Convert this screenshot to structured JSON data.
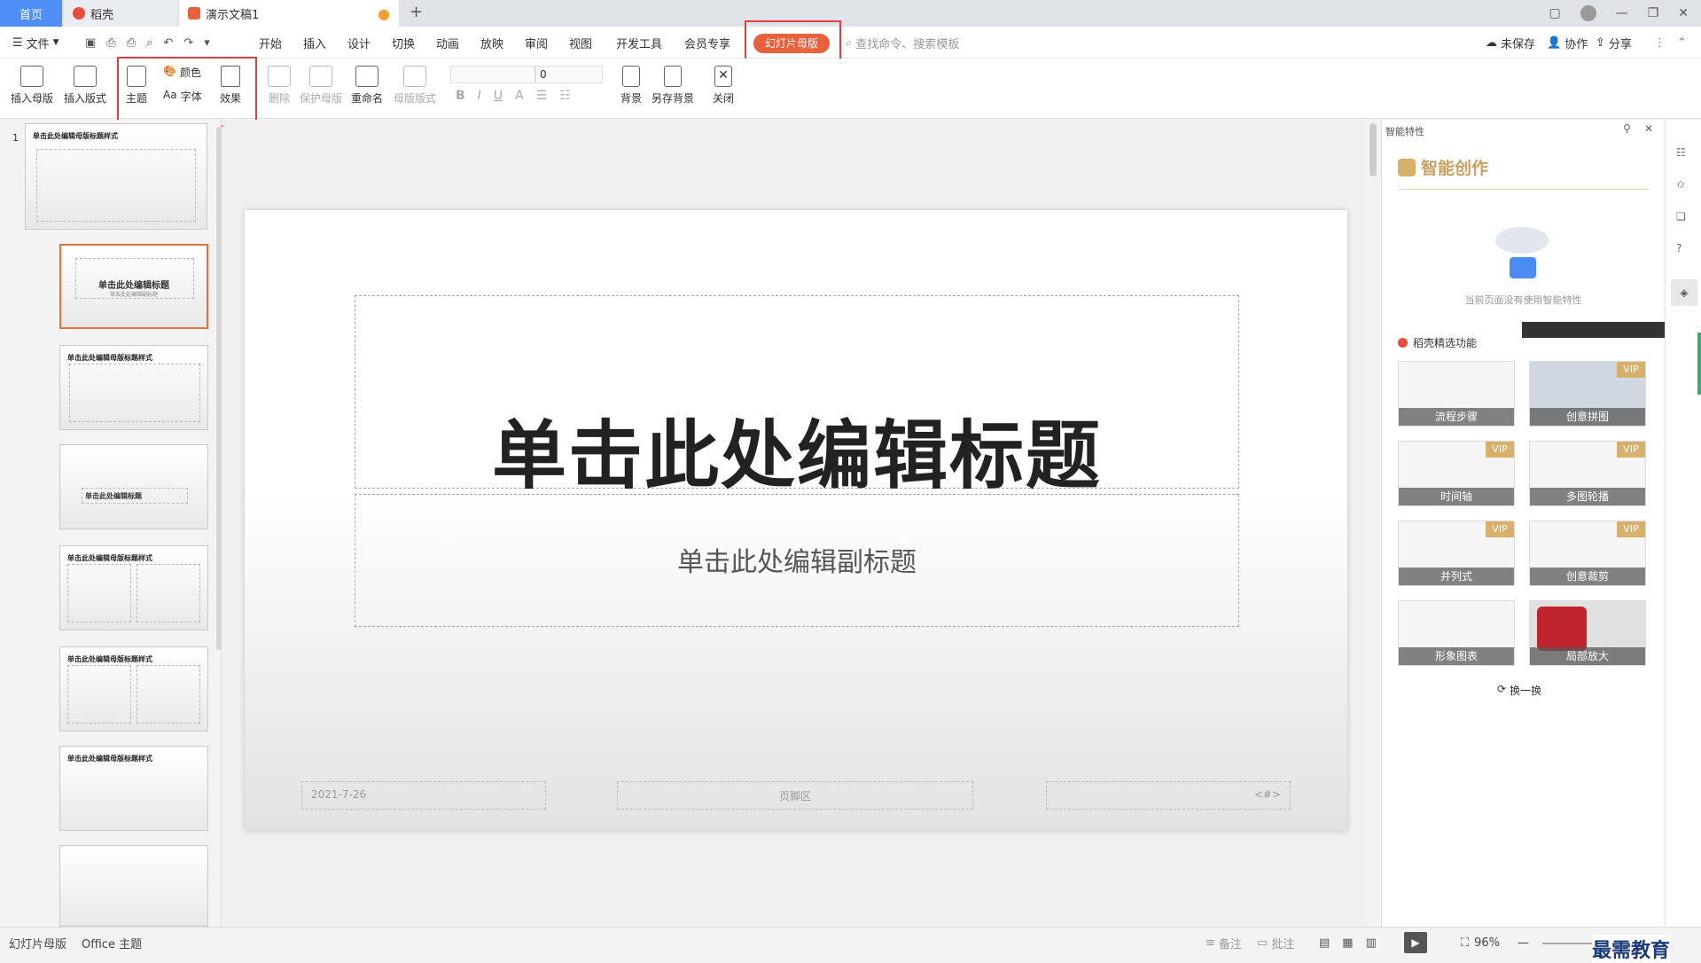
{
  "tabs": {
    "home": "首页",
    "docer": "稻壳",
    "doc": "演示文稿1"
  },
  "menu": {
    "file": "文件",
    "items": [
      "开始",
      "插入",
      "设计",
      "切换",
      "动画",
      "放映",
      "审阅",
      "视图",
      "开发工具",
      "会员专享"
    ],
    "active": "幻灯片母版",
    "search": "查找命令、搜索模板",
    "unsaved": "未保存",
    "collab": "协作",
    "share": "分享"
  },
  "ribbon": {
    "insert_master": "插入母版",
    "insert_layout": "插入版式",
    "theme": "主题",
    "color": "颜色",
    "font": "字体",
    "font_prefix": "Aa",
    "effect": "效果",
    "delete": "删除",
    "protect": "保护母版",
    "rename": "重命名",
    "master_layout": "母版版式",
    "font_size": "0",
    "background": "背景",
    "save_bg": "另存背景",
    "close": "关闭"
  },
  "thumbs": {
    "num": "1",
    "master_title": "单击此处编辑母版标题样式",
    "t2": "单击此处编辑标题",
    "t2sub": "单击此处编辑副标题",
    "t4": "单击此处编辑标题"
  },
  "slide": {
    "title": "单击此处编辑标题",
    "subtitle": "单击此处编辑副标题",
    "date": "2021-7-26",
    "footer": "页脚区",
    "num": "<#>"
  },
  "rpanel": {
    "header": "智能特性",
    "smart": "智能创作",
    "empty": "当前页面没有使用智能特性",
    "section": "稻壳精选功能",
    "refresh": "换一换",
    "vip": "VIP",
    "features": [
      "流程步骤",
      "创意拼图",
      "时间轴",
      "多图轮播",
      "并列式",
      "创意裁剪",
      "形象图表",
      "局部放大"
    ]
  },
  "status": {
    "mode": "幻灯片母版",
    "theme": "Office 主题",
    "notes": "备注",
    "comments": "批注",
    "zoom": "96%"
  },
  "watermark": "最需教育"
}
